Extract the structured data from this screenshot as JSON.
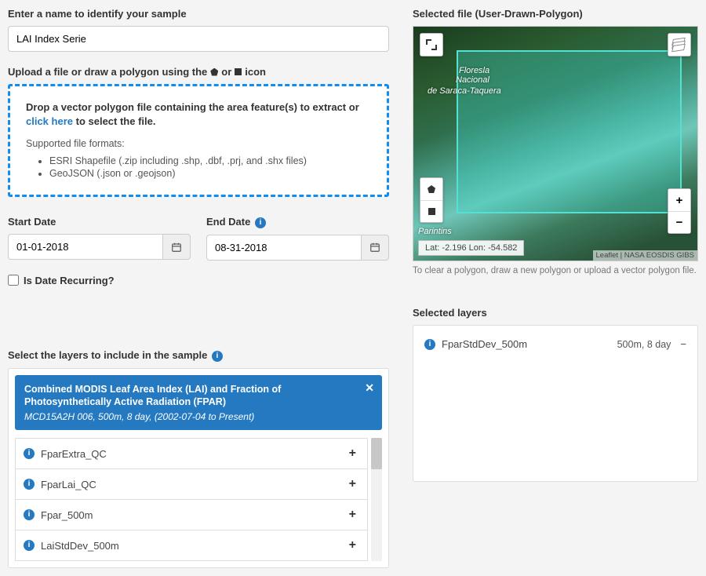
{
  "sample_name": {
    "label": "Enter a name to identify your sample",
    "value": "LAI Index Serie"
  },
  "upload": {
    "label_prefix": "Upload a file or draw a polygon using the ",
    "label_or": " or ",
    "label_suffix": " icon",
    "drop_text_pre": "Drop a vector polygon file containing the area feature(s) to extract or ",
    "click_here": "click here",
    "drop_text_post": " to select the file.",
    "formats_label": "Supported file formats:",
    "formats": [
      "ESRI Shapefile (.zip including .shp, .dbf, .prj, and .shx files)",
      "GeoJSON (.json or .geojson)"
    ]
  },
  "dates": {
    "start_label": "Start Date",
    "end_label": "End Date",
    "start_value": "01-01-2018",
    "end_value": "08-31-2018",
    "recurring_label": "Is Date Recurring?"
  },
  "layers_section": {
    "label": "Select the layers to include in the sample",
    "group_title": "Combined MODIS Leaf Area Index (LAI) and Fraction of Photosynthetically Active Radiation (FPAR)",
    "group_sub": "MCD15A2H 006, 500m, 8 day, (2002-07-04 to Present)",
    "items": [
      {
        "name": "FparExtra_QC"
      },
      {
        "name": "FparLai_QC"
      },
      {
        "name": "Fpar_500m"
      },
      {
        "name": "LaiStdDev_500m"
      }
    ]
  },
  "selected_file": {
    "label_prefix": "Selected file (",
    "filename": "User-Drawn-Polygon",
    "label_suffix": ")",
    "latlon": "Lat: -2.196 Lon: -54.582",
    "attribution": "Leaflet | NASA EOSDIS GIBS",
    "clear_note": "To clear a polygon, draw a new polygon or upload a vector polygon file.",
    "map_labels": {
      "floresta": "Floresla",
      "nacional": "Nacional",
      "saraca": "de Saraca-Taquera",
      "parintins": "Parintins"
    }
  },
  "selected_layers": {
    "label": "Selected layers",
    "items": [
      {
        "name": "FparStdDev_500m",
        "meta": "500m, 8 day"
      }
    ]
  }
}
